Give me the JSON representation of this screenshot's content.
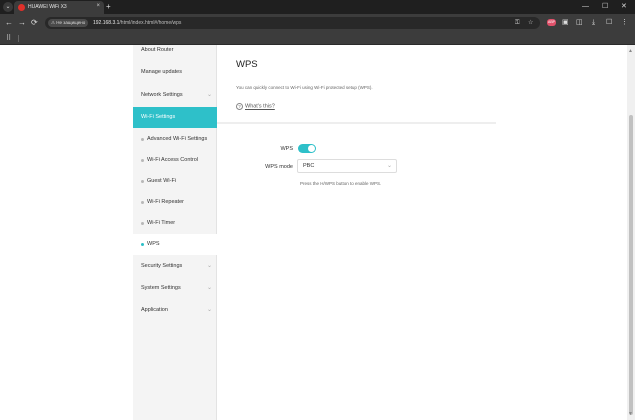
{
  "browser": {
    "tab_title": "HUAWEI WiFi X3",
    "tab_close": "×",
    "new_tab": "+",
    "menu_icon": "⌄",
    "security_label": "Не защищено",
    "url_host": "192.168.3.1",
    "url_path": "/html/index.html#/home/wps",
    "window_minimize": "—",
    "window_maximize": "☐",
    "window_close": "✕",
    "back": "←",
    "forward": "→",
    "reload": "⟳",
    "bookmark_star": "☆",
    "ext_badge": "ABP",
    "apps_icon": "⠿"
  },
  "sidebar": {
    "items": [
      {
        "label": "About Router",
        "chevron": ""
      },
      {
        "label": "Manage updates",
        "chevron": ""
      },
      {
        "label": "Network Settings",
        "chevron": "⌄"
      },
      {
        "label": "Wi-Fi Settings",
        "chevron": "⌃"
      }
    ],
    "subitems": [
      {
        "label": "Advanced Wi-Fi Settings"
      },
      {
        "label": "Wi-Fi Access Control"
      },
      {
        "label": "Guest Wi-Fi"
      },
      {
        "label": "Wi-Fi Repeater"
      },
      {
        "label": "Wi-Fi Timer"
      },
      {
        "label": "WPS"
      }
    ],
    "bottom_items": [
      {
        "label": "Security Settings",
        "chevron": "⌄"
      },
      {
        "label": "System Settings",
        "chevron": "⌄"
      },
      {
        "label": "Application",
        "chevron": "⌄"
      }
    ]
  },
  "main": {
    "title": "WPS",
    "description": "You can quickly connect to Wi-Fi using Wi-Fi protected setup (WPS).",
    "help_icon": "?",
    "help_link": "What's this?",
    "wps_label": "WPS",
    "wps_enabled": true,
    "mode_label": "WPS mode",
    "mode_value": "PBC",
    "mode_chevron": "⌄",
    "hint": "Press the H/WPS button to enable WPS."
  },
  "colors": {
    "accent": "#2ec0c9"
  }
}
